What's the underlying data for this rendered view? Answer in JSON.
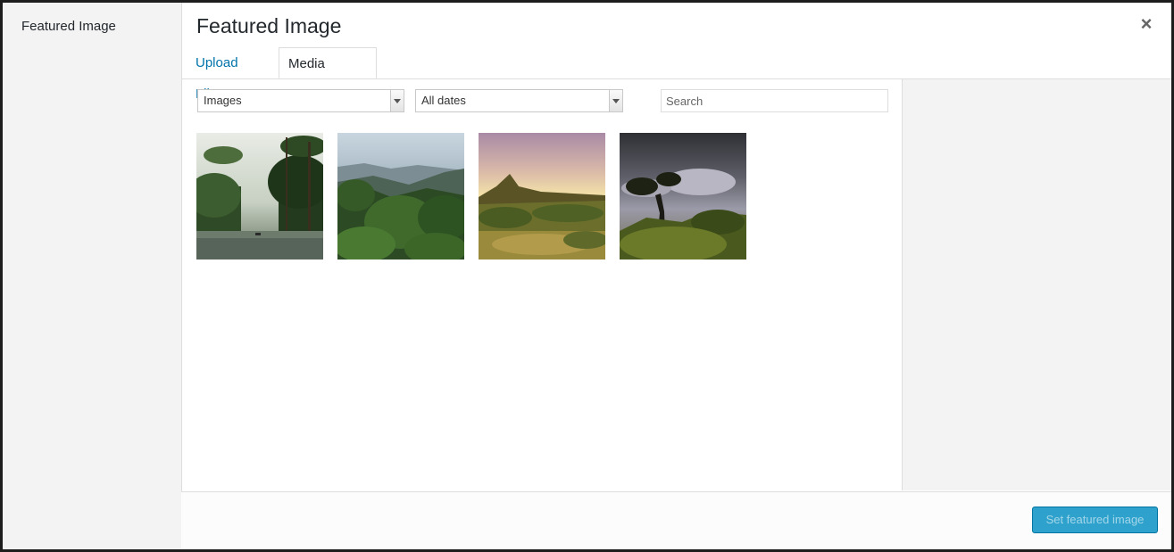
{
  "sidebar": {
    "title": "Featured Image"
  },
  "modal": {
    "title": "Featured Image",
    "close_icon": "close-icon"
  },
  "tabs": [
    {
      "label": "Upload Files",
      "active": false
    },
    {
      "label": "Media Library",
      "active": true
    }
  ],
  "toolbar": {
    "type_filter": {
      "selected": "Images",
      "icon": "chevron-down-icon"
    },
    "date_filter": {
      "selected": "All dates",
      "icon": "chevron-down-icon"
    },
    "search": {
      "placeholder": "Search",
      "value": ""
    }
  },
  "attachments": [
    {
      "name": "attachment-river-palms",
      "description": "jungle river with palm trees"
    },
    {
      "name": "attachment-forest-hills",
      "description": "forested hills under hazy sky"
    },
    {
      "name": "attachment-mountain-sunset",
      "description": "mountain peak at sunset"
    },
    {
      "name": "attachment-stormy-trees",
      "description": "trees under stormy sky"
    }
  ],
  "footer": {
    "primary_button": "Set featured image"
  },
  "colors": {
    "link": "#0073aa",
    "primary_button_bg": "#2ea2cc",
    "primary_button_text": "#a4d6ea",
    "sidebar_bg": "#f3f3f3"
  }
}
